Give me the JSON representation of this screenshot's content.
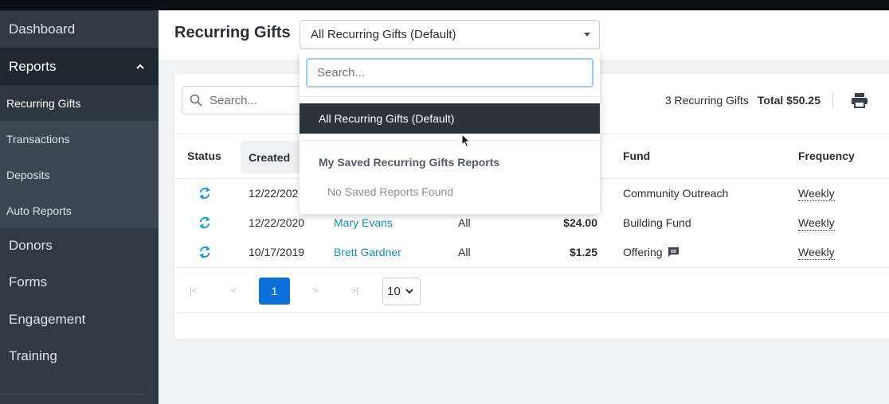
{
  "sidebar": {
    "items": [
      {
        "label": "Dashboard"
      },
      {
        "label": "Reports"
      },
      {
        "label": "Donors"
      },
      {
        "label": "Forms"
      },
      {
        "label": "Engagement"
      },
      {
        "label": "Training"
      }
    ],
    "reports_subitems": [
      {
        "label": "Recurring Gifts"
      },
      {
        "label": "Transactions"
      },
      {
        "label": "Deposits"
      },
      {
        "label": "Auto Reports"
      }
    ]
  },
  "header": {
    "title": "Recurring Gifts",
    "select_value": "All Recurring Gifts (Default)"
  },
  "toolbar": {
    "search_placeholder": "Search...",
    "count_text": "3 Recurring Gifts",
    "total_text": "Total $50.25"
  },
  "table": {
    "columns": {
      "status": "Status",
      "created": "Created",
      "fund": "Fund",
      "frequency": "Frequency"
    },
    "rows": [
      {
        "created": "12/22/202",
        "name": "",
        "segment": "",
        "amount": "",
        "fund": "Community Outreach",
        "frequency": "Weekly"
      },
      {
        "created": "12/22/2020",
        "name": "Mary Evans",
        "segment": "All",
        "amount": "$24.00",
        "fund": "Building Fund",
        "frequency": "Weekly"
      },
      {
        "created": "10/17/2019",
        "name": "Brett Gardner",
        "segment": "All",
        "amount": "$1.25",
        "fund": "Offering",
        "frequency": "Weekly"
      }
    ]
  },
  "pagination": {
    "first": "|<",
    "prev": "<",
    "current_page": "1",
    "next": ">",
    "last": ">|",
    "page_size": "10"
  },
  "dropdown": {
    "search_placeholder": "Search...",
    "selected_option": "All Recurring Gifts (Default)",
    "group_label": "My Saved Recurring Gifts Reports",
    "empty_text": "No Saved Reports Found"
  },
  "colors": {
    "sidebar_bg": "#2f3a45",
    "accent_blue": "#0d6fd8",
    "link": "#1a8fb8",
    "status_icon": "#1a9fd0"
  }
}
